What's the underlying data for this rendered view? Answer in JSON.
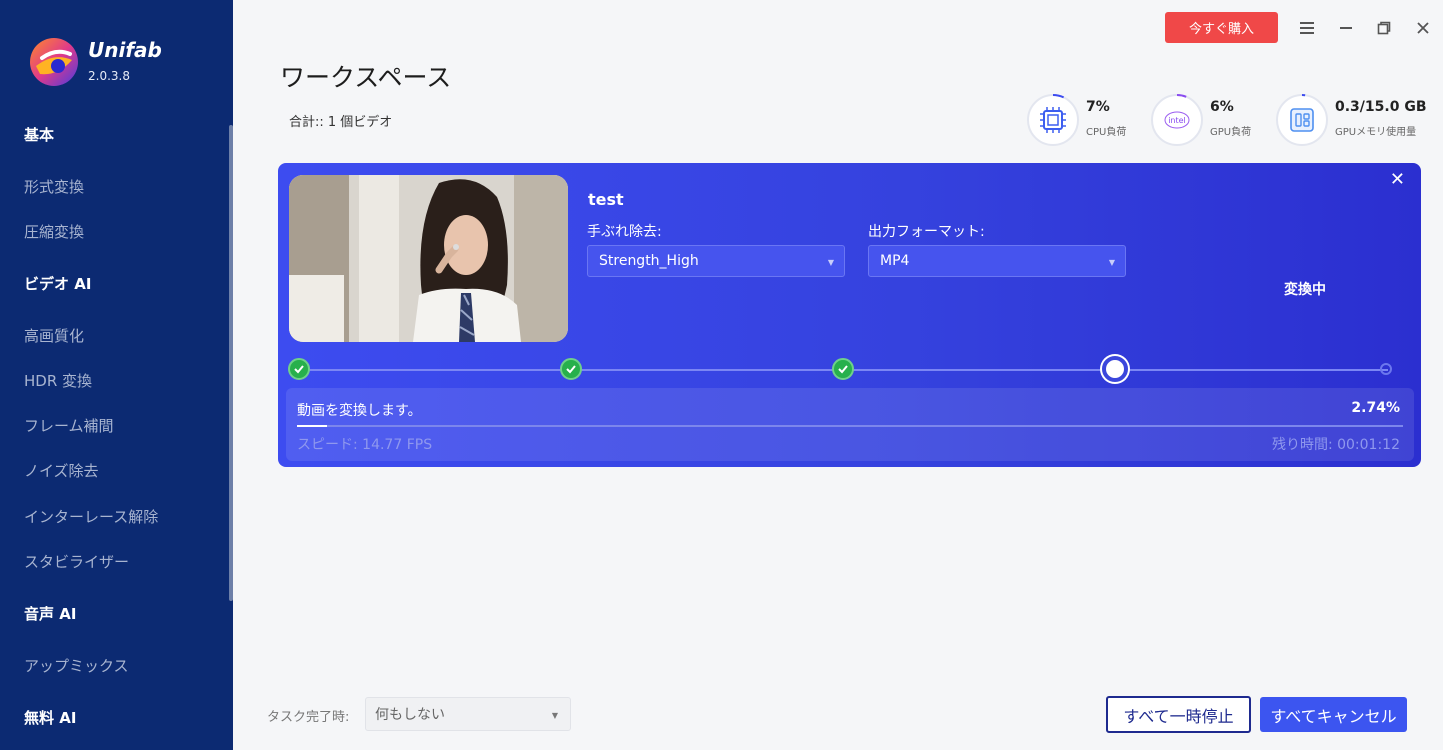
{
  "app": {
    "name": "Unifab",
    "version": "2.0.3.8"
  },
  "sidebar": {
    "sections": [
      {
        "header": "基本",
        "items": [
          "形式変換",
          "圧縮変換"
        ]
      },
      {
        "header": "ビデオ AI",
        "items": [
          "高画質化",
          "HDR 変換",
          "フレーム補間",
          "ノイズ除去",
          "インターレース解除",
          "スタビライザー"
        ]
      },
      {
        "header": "音声 AI",
        "items": [
          "アップミックス"
        ]
      },
      {
        "header": "無料 AI",
        "items": []
      }
    ]
  },
  "titlebar": {
    "buy_label": "今すぐ購入"
  },
  "workspace": {
    "title": "ワークスペース",
    "total": "合計:: 1 個ビデオ"
  },
  "stats": {
    "cpu": {
      "value": "7%",
      "label": "CPU負荷",
      "icon": "cpu-chip-icon",
      "fraction": 0.07
    },
    "gpu": {
      "value": "6%",
      "label": "GPU負荷",
      "icon": "intel-icon",
      "icon_text": "intel",
      "fraction": 0.06
    },
    "mem": {
      "value": "0.3/15.0 GB",
      "label": "GPUメモリ使用量",
      "icon": "memory-icon",
      "fraction": 0.02
    }
  },
  "task": {
    "name": "test",
    "stabilize_label": "手ぶれ除去:",
    "stabilize_value": "Strength_High",
    "format_label": "出力フォーマット:",
    "format_value": "MP4",
    "status": "変換中",
    "steps": [
      "done",
      "done",
      "done",
      "current",
      "pending"
    ],
    "progress_text": "動画を変換します。",
    "progress_percent": "2.74%",
    "progress_fraction": 0.0274,
    "speed": "スピード: 14.77  FPS",
    "remaining": "残り時間: 00:01:12"
  },
  "footer": {
    "after_label": "タスク完了時:",
    "after_value": "何もしない",
    "pause_all": "すべて一時停止",
    "cancel_all": "すべてキャンセル"
  },
  "colors": {
    "sidebar_bg": "#0c2a72",
    "card_bg": "#3542de",
    "buy": "#f04848",
    "success": "#27b04c",
    "cancel": "#3c55f0"
  }
}
